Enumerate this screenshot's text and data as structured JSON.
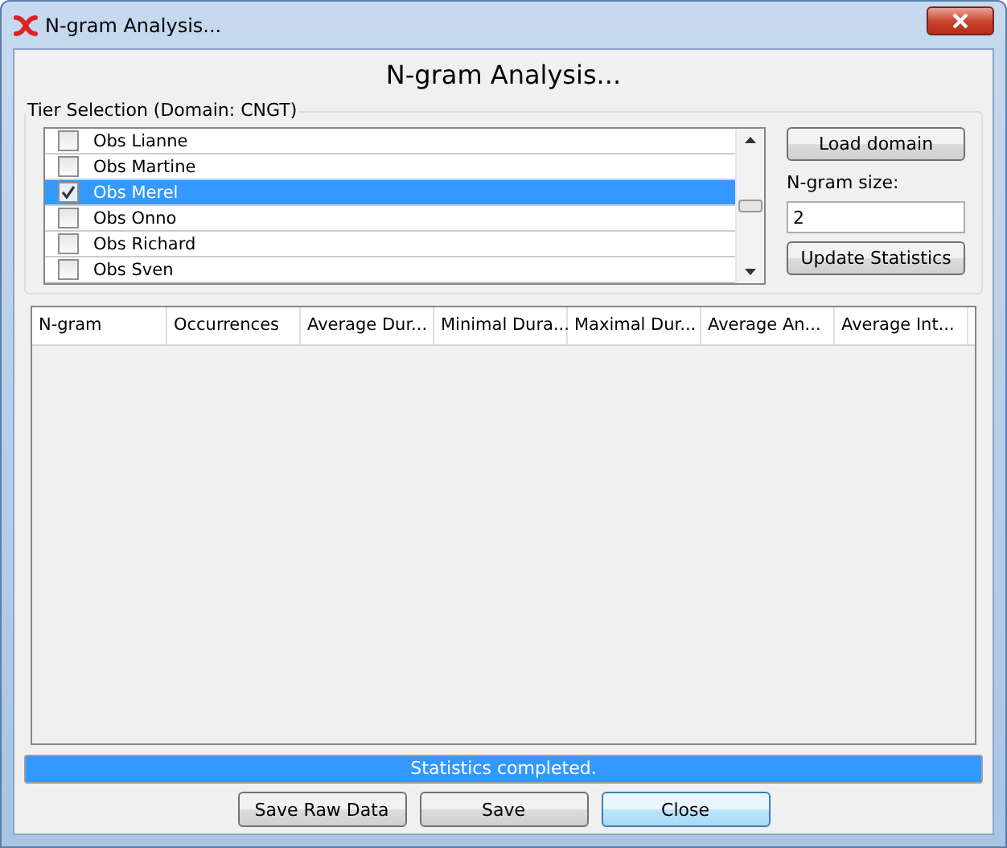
{
  "window": {
    "title": "N-gram Analysis..."
  },
  "heading": "N-gram Analysis...",
  "tier_selection": {
    "title": "Tier Selection (Domain: CNGT)",
    "tiers": [
      {
        "name": "Obs Lianne",
        "checked": false,
        "selected": false
      },
      {
        "name": "Obs Martine",
        "checked": false,
        "selected": false
      },
      {
        "name": "Obs Merel",
        "checked": true,
        "selected": true
      },
      {
        "name": "Obs Onno",
        "checked": false,
        "selected": false
      },
      {
        "name": "Obs Richard",
        "checked": false,
        "selected": false
      },
      {
        "name": "Obs Sven",
        "checked": false,
        "selected": false
      }
    ]
  },
  "load_domain_button": "Load domain",
  "ngram_size": {
    "label": "N-gram size:",
    "value": "2"
  },
  "update_button": "Update Statistics",
  "table": {
    "columns": [
      "N-gram",
      "Occurrences",
      "Average Dur...",
      "Minimal Dura...",
      "Maximal Dur...",
      "Average An...",
      "Average Int..."
    ]
  },
  "progress": {
    "text": "Statistics completed.",
    "level": 1
  },
  "buttons": [
    {
      "label": "Save Raw Data",
      "default": false
    },
    {
      "label": "Save",
      "default": false
    },
    {
      "label": "Close",
      "default": true
    }
  ]
}
